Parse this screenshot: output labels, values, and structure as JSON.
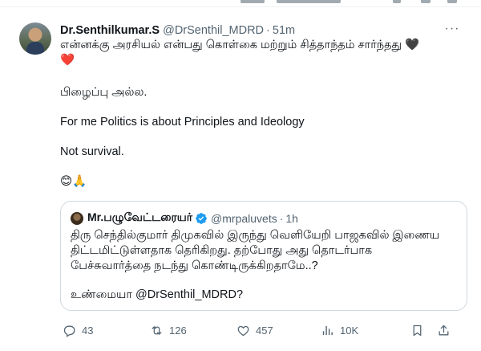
{
  "tweet": {
    "author_name": "Dr.Senthilkumar.S",
    "author_handle": "@DrSenthil_MDRD",
    "separator": "·",
    "time": "51m",
    "more_label": "···",
    "text_line1": "என்னக்கு அரசியல் என்பது கொள்கை மற்றும் சித்தாந்தம் சார்ந்தது",
    "hearts": [
      "🖤",
      "❤️"
    ],
    "text_line2": "பிழைப்பு அல்ல.",
    "text_line3": "For me Politics is about Principles and Ideology",
    "text_line4": "Not survival.",
    "emojis": "😊🙏"
  },
  "quote": {
    "author_name": "Mr.பழுவேட்டரையர்",
    "author_handle": "@mrpaluvets",
    "separator": "·",
    "time": "1h",
    "text": "திரு செந்தில்குமார் திமுகவில் இருந்து வெளியேறி பாஜகவில் இணைய திட்டமிட்டுள்ளதாக தெரிகிறது. தற்போது அது தொடர்பாக பேச்சுவார்த்தை நடந்து கொண்டிருக்கிறதாமே..?",
    "text2": "உண்மையா @DrSenthil_MDRD?",
    "verified_color": "#1d9bf0"
  },
  "actions": {
    "replies": "43",
    "reposts": "126",
    "likes": "457",
    "views": "10K"
  },
  "icons": [
    "reply-icon",
    "repost-icon",
    "like-icon",
    "views-icon",
    "bookmark-icon",
    "share-icon",
    "more-icon",
    "verified-icon"
  ]
}
